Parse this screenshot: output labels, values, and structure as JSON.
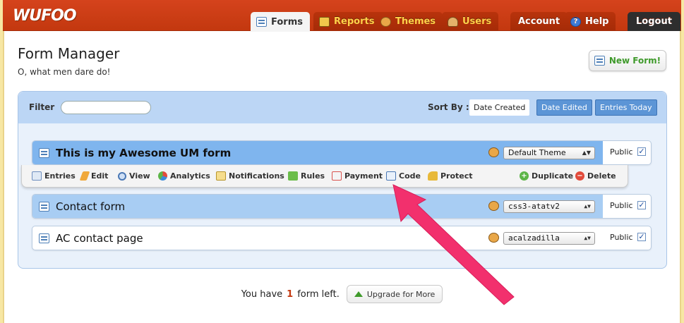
{
  "brand": {
    "logo": "WUFOO"
  },
  "nav": {
    "tabs": [
      {
        "label": "Forms",
        "icon": "form-icon",
        "active": true
      },
      {
        "label": "Reports",
        "icon": "reports-icon"
      },
      {
        "label": "Themes",
        "icon": "themes-icon"
      },
      {
        "label": "Users",
        "icon": "users-icon"
      }
    ],
    "account": "Account",
    "help": "Help",
    "logout": "Logout"
  },
  "header": {
    "title": "Form Manager",
    "subtitle": "O, what men dare do!",
    "new_form": "New Form!"
  },
  "filter": {
    "label": "Filter",
    "value": "",
    "sort_label": "Sort By :",
    "sort_options": [
      "Date Created",
      "Date Edited",
      "Entries Today"
    ],
    "sort_selected": "Date Created"
  },
  "forms": [
    {
      "name": "This is my Awesome UM form",
      "theme": "Default Theme",
      "public_label": "Public",
      "public": true
    },
    {
      "name": "Contact form",
      "theme": "css3-atatv2",
      "public_label": "Public",
      "public": true
    },
    {
      "name": "AC contact page",
      "theme": "acalzadilla",
      "public_label": "Public",
      "public": true
    }
  ],
  "actions": {
    "entries": "Entries",
    "edit": "Edit",
    "view": "View",
    "analytics": "Analytics",
    "notifications": "Notifications",
    "rules": "Rules",
    "payment": "Payment",
    "code": "Code",
    "protect": "Protect",
    "duplicate": "Duplicate",
    "delete": "Delete"
  },
  "footer": {
    "prefix": "You have",
    "count": "1",
    "suffix": "form left.",
    "upgrade": "Upgrade for More"
  },
  "colors": {
    "brand": "#c3380f",
    "annotation_arrow": "#f2306d",
    "row_highlight": "#7fb5ee",
    "row_hover": "#a8cdf3"
  }
}
